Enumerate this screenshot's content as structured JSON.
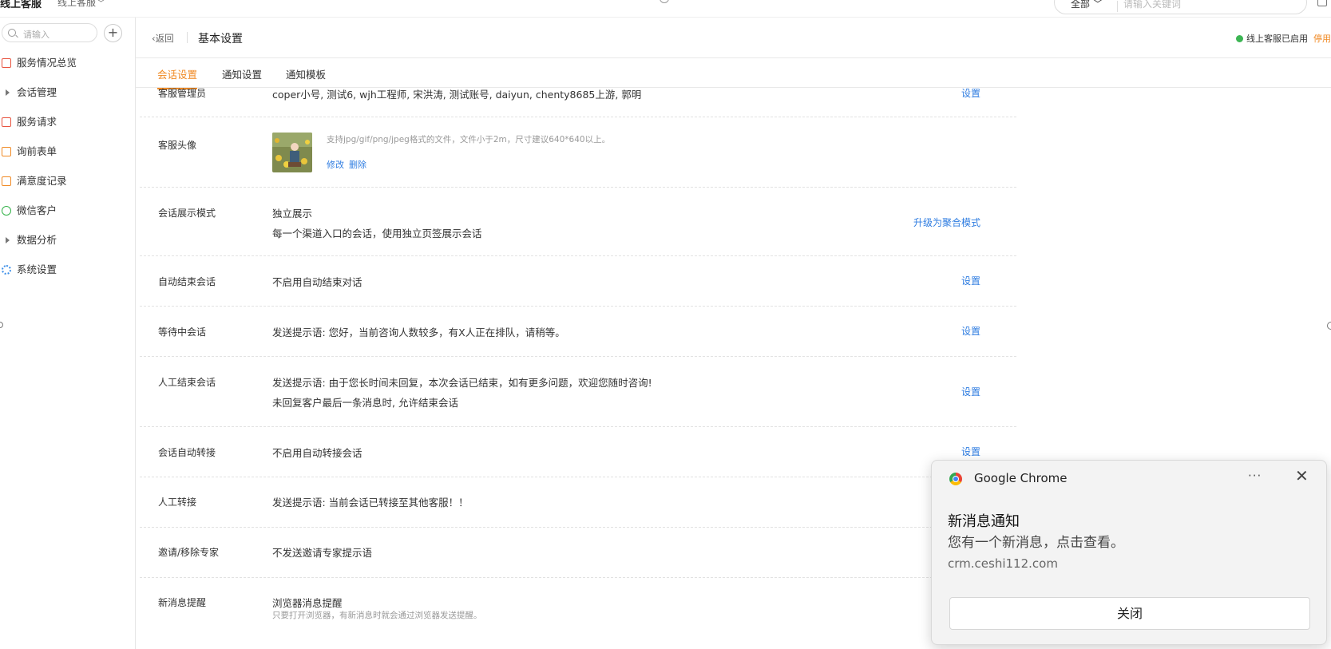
{
  "topbar": {
    "app_title": "线上客服",
    "app_switch": "线上客服",
    "search_scope": "全部",
    "search_placeholder": "请输入关键词"
  },
  "sidebar": {
    "search_placeholder": "请输入",
    "add_label": "+",
    "items": [
      {
        "label": "服务情况总览",
        "icon": "monitor-icon",
        "color": "#e8533f"
      },
      {
        "label": "会话管理",
        "icon": "expand-arrow-icon",
        "color": "#777777"
      },
      {
        "label": "服务请求",
        "icon": "request-icon",
        "color": "#e8533f"
      },
      {
        "label": "询前表单",
        "icon": "form-icon",
        "color": "#f08a24"
      },
      {
        "label": "满意度记录",
        "icon": "rating-icon",
        "color": "#f08a24"
      },
      {
        "label": "微信客户",
        "icon": "wechat-icon",
        "color": "#35b34a"
      },
      {
        "label": "数据分析",
        "icon": "expand-arrow-icon",
        "color": "#777777"
      },
      {
        "label": "系统设置",
        "icon": "gear-icon",
        "color": "#3b8ee8"
      }
    ]
  },
  "header": {
    "back_label": "返回",
    "page_title": "基本设置",
    "status_text": "线上客服已启用",
    "status_color": "#3cb553",
    "disable_label": "停用"
  },
  "tabs": [
    {
      "label": "会话设置",
      "active": true
    },
    {
      "label": "通知设置",
      "active": false
    },
    {
      "label": "通知模板",
      "active": false
    }
  ],
  "accent_color": "#f08a24",
  "link_color": "#2f7de1",
  "settings": {
    "admins": {
      "label": "客服管理员",
      "value": "coper小号, 测试6, wjh工程师, 宋洪涛, 测试账号, daiyun, chenty8685上游, 郭明",
      "action": "设置"
    },
    "avatar": {
      "label": "客服头像",
      "hint": "支持jpg/gif/png/jpeg格式的文件，文件小于2m，尺寸建议640*640以上。",
      "edit": "修改",
      "delete": "删除"
    },
    "display_mode": {
      "label": "会话展示模式",
      "value": "独立展示",
      "desc": "每一个渠道入口的会话，使用独立页签展示会话",
      "action": "升级为聚合模式"
    },
    "auto_end": {
      "label": "自动结束会话",
      "value": "不启用自动结束对话",
      "action": "设置"
    },
    "waiting": {
      "label": "等待中会话",
      "value": "发送提示语: 您好，当前咨询人数较多，有X人正在排队，请稍等。",
      "action": "设置"
    },
    "manual_end": {
      "label": "人工结束会话",
      "value": "发送提示语: 由于您长时间未回复，本次会话已结束，如有更多问题，欢迎您随时咨询!",
      "desc": "未回复客户最后一条消息时, 允许结束会话",
      "action": "设置"
    },
    "auto_transfer": {
      "label": "会话自动转接",
      "value": "不启用自动转接会话",
      "action": "设置"
    },
    "manual_transfer": {
      "label": "人工转接",
      "value": "发送提示语: 当前会话已转接至其他客服！！"
    },
    "invite_expert": {
      "label": "邀请/移除专家",
      "value": "不发送邀请专家提示语"
    },
    "new_msg": {
      "label": "新消息提醒",
      "value": "浏览器消息提醒",
      "desc": "只要打开浏览器，有新消息时就会通过浏览器发送提醒。"
    }
  },
  "notification": {
    "app_name": "Google Chrome",
    "more_label": "···",
    "close_icon": "✕",
    "title": "新消息通知",
    "body": "您有一个新消息，点击查看。",
    "site": "crm.ceshi112.com",
    "close_button": "关闭"
  }
}
